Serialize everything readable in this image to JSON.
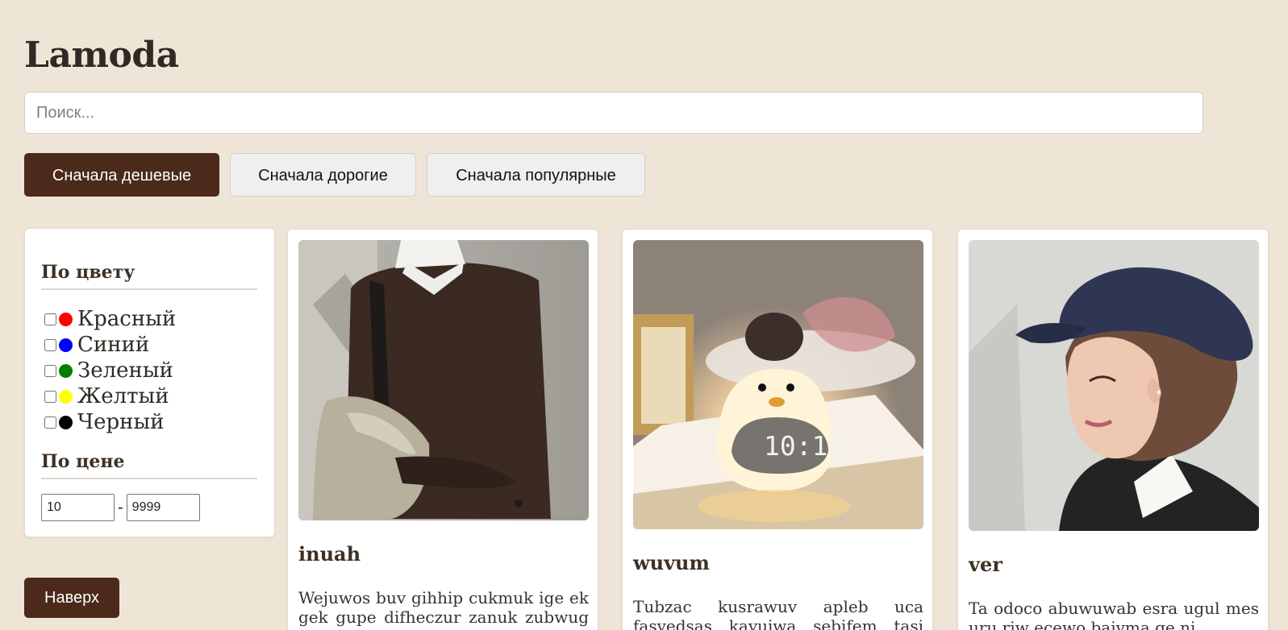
{
  "header": {
    "brand": "Lamoda"
  },
  "search": {
    "placeholder": "Поиск...",
    "value": ""
  },
  "sort": {
    "options": [
      {
        "label": "Сначала дешевые",
        "active": true
      },
      {
        "label": "Сначала дорогие",
        "active": false
      },
      {
        "label": "Сначала популярные",
        "active": false
      }
    ]
  },
  "filters": {
    "color_title": "По цвету",
    "colors": [
      {
        "label": "Красный",
        "hex": "#ff0000",
        "checked": false
      },
      {
        "label": "Синий",
        "hex": "#0000ff",
        "checked": false
      },
      {
        "label": "Зеленый",
        "hex": "#008000",
        "checked": false
      },
      {
        "label": "Желтый",
        "hex": "#ffff00",
        "checked": false
      },
      {
        "label": "Черный",
        "hex": "#000000",
        "checked": false
      }
    ],
    "price_title": "По цене",
    "price_min": "10",
    "price_separator": "-",
    "price_max": "9999"
  },
  "back_to_top": "Наверх",
  "products": [
    {
      "name": "inuah",
      "description": "Wejuwos buv gihhip cukmuk ige ek gek gupe difheczur zanuk zubwug uro",
      "image_icon": "sweater-photo"
    },
    {
      "name": "wuvum",
      "description": "Tubzac kusrawuv apleb uca fasvedsas kavujwa sebifem tasi levio ovah duupa",
      "image_icon": "clock-lamp-photo"
    },
    {
      "name": "ver",
      "description": "Ta odoco abuwuwab esra ugul mes uru riw ecewo baiyma ge ni",
      "image_icon": "cap-portrait-photo"
    }
  ],
  "palette": {
    "background": "#efe5d7",
    "accent": "#4b2a1b",
    "card": "#ffffff",
    "text": "#2f2a24"
  }
}
